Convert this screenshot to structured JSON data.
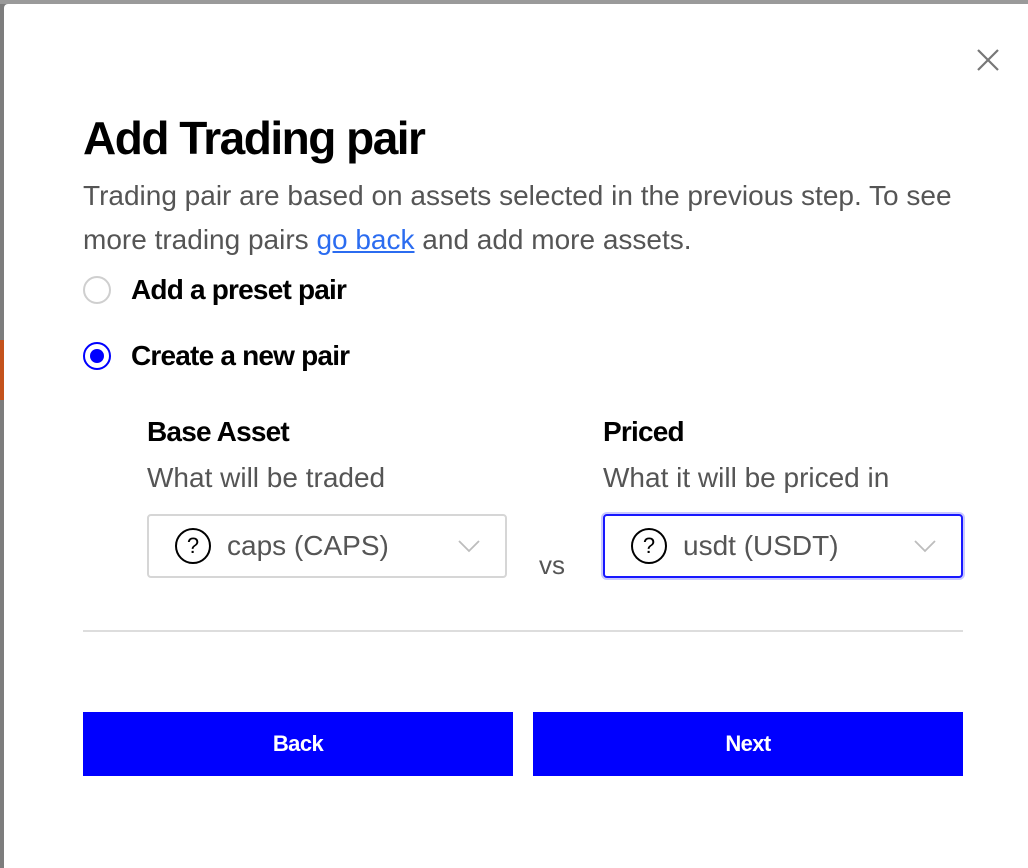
{
  "dialog": {
    "title": "Add Trading pair",
    "description_before_link": "Trading pair are based on assets selected in the previous step. To see more trading pairs ",
    "description_link": "go back",
    "description_after_link": " and add more assets."
  },
  "options": [
    {
      "label": "Add a preset pair",
      "checked": false
    },
    {
      "label": "Create a new pair",
      "checked": true
    }
  ],
  "base_asset": {
    "label": "Base Asset",
    "sublabel": "What will be traded",
    "value": "caps (CAPS)",
    "icon": "question-circle-icon"
  },
  "separator": "vs",
  "priced": {
    "label": "Priced",
    "sublabel": "What it will be priced in",
    "value": "usdt (USDT)",
    "icon": "question-circle-icon"
  },
  "buttons": {
    "back": "Back",
    "next": "Next"
  },
  "colors": {
    "primary": "#0000ff",
    "link": "#2b6cf0",
    "muted_text": "#555555"
  }
}
